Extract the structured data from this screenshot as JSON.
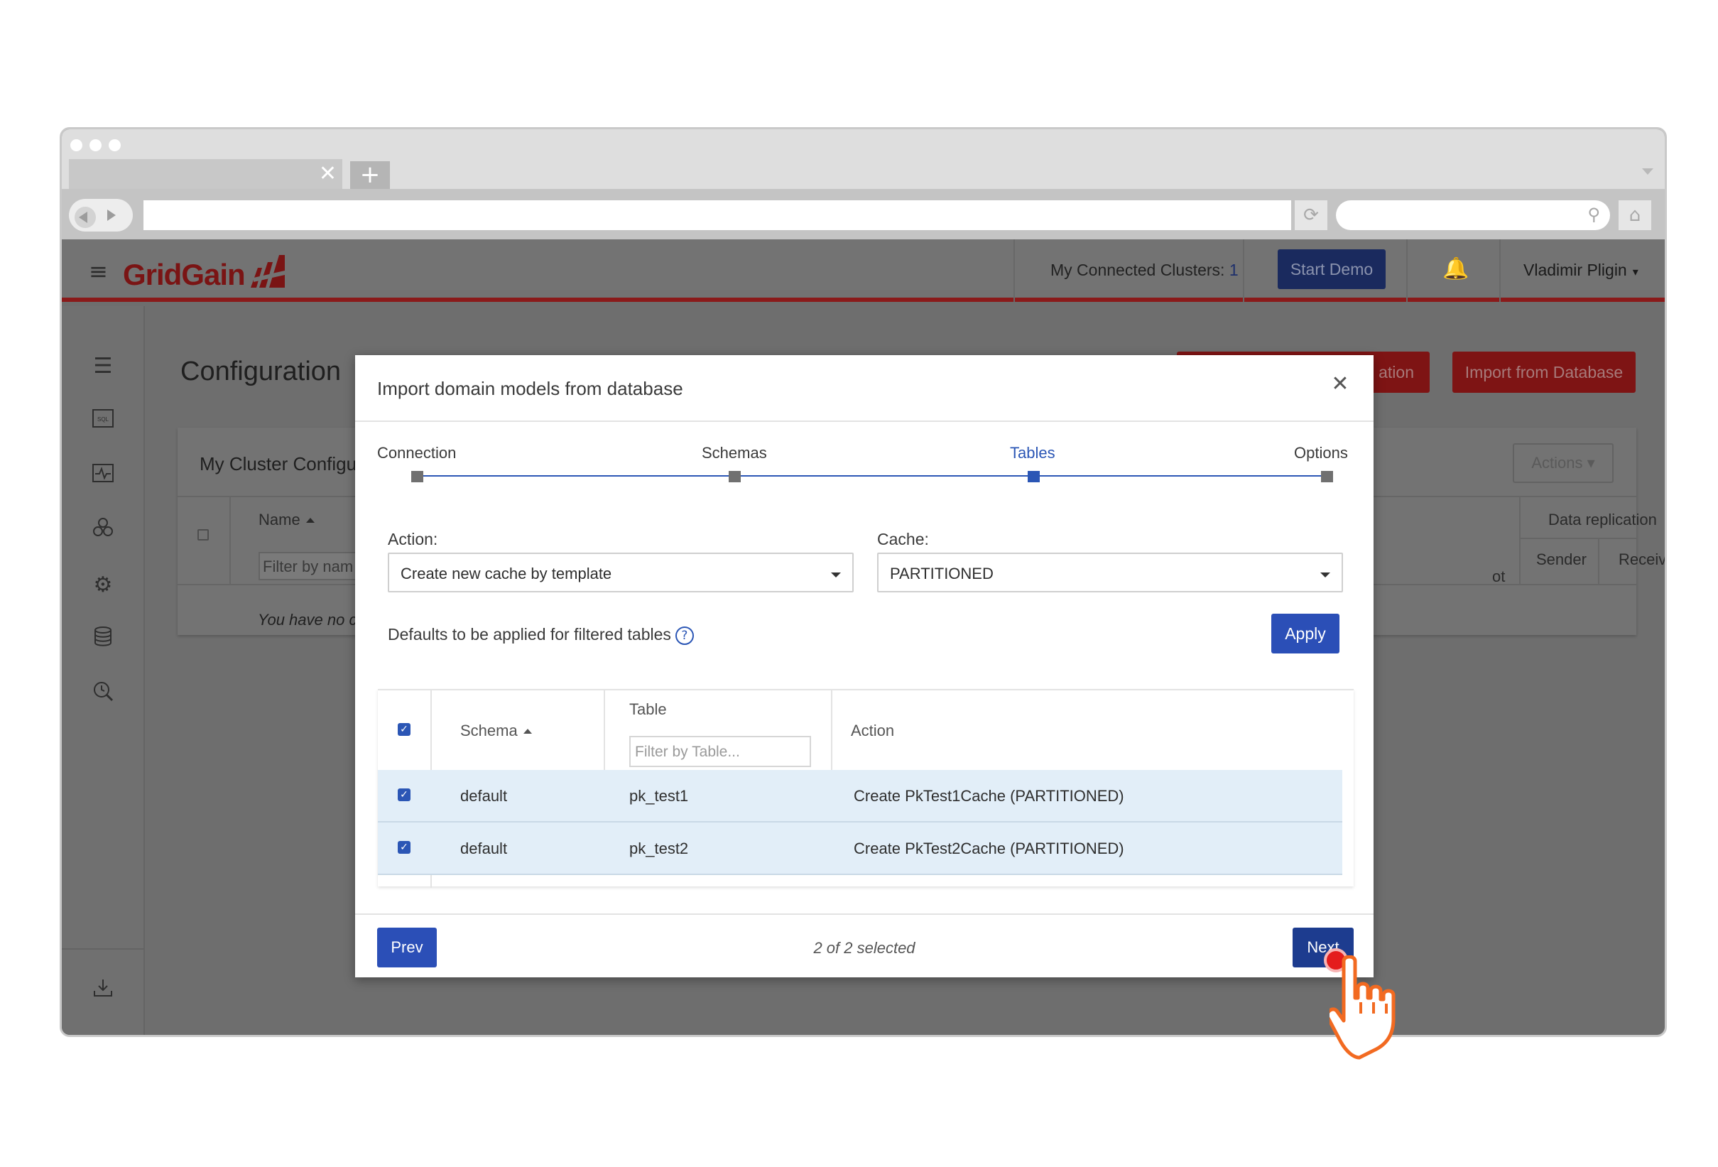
{
  "browser": {
    "tab_close": "✕",
    "new_tab": "+",
    "reload_icon": "reload-icon",
    "search_icon": "search-icon",
    "home_icon": "home-icon"
  },
  "header": {
    "logo_text": "GridGain",
    "connected_clusters_label": "My Connected Clusters:",
    "connected_clusters_count": "1",
    "start_demo": "Start Demo",
    "user_name": "Vladimir Pligin"
  },
  "sidebar": {
    "items": [
      {
        "icon": "sliders-icon"
      },
      {
        "icon": "sql-icon"
      },
      {
        "icon": "monitoring-icon"
      },
      {
        "icon": "cluster-icon"
      },
      {
        "icon": "gear-icon"
      },
      {
        "icon": "database-icon"
      },
      {
        "icon": "search-clock-icon"
      },
      {
        "icon": "download-icon"
      }
    ]
  },
  "page": {
    "title": "Configuration",
    "create_button_partial": "ation",
    "import_button": "Import from Database",
    "card_title": "My Cluster Configu",
    "actions_button": "Actions",
    "col_name": "Name",
    "filter_placeholder": "Filter by nam",
    "col_snapshot_partial": "ot",
    "col_data_replication": "Data replication",
    "col_sender": "Sender",
    "col_receiver": "Receiver",
    "empty_text": "You have no c"
  },
  "modal": {
    "title": "Import domain models from database",
    "steps": [
      {
        "label": "Connection",
        "active": false
      },
      {
        "label": "Schemas",
        "active": false
      },
      {
        "label": "Tables",
        "active": true
      },
      {
        "label": "Options",
        "active": false
      }
    ],
    "action_label": "Action:",
    "action_value": "Create new cache by template",
    "cache_label": "Cache:",
    "cache_value": "PARTITIONED",
    "defaults_text": "Defaults to be applied for filtered tables",
    "help_glyph": "?",
    "apply_button": "Apply",
    "grid": {
      "col_schema": "Schema",
      "col_table": "Table",
      "table_filter_placeholder": "Filter by Table...",
      "col_action": "Action",
      "rows": [
        {
          "schema": "default",
          "table": "pk_test1",
          "action": "Create PkTest1Cache (PARTITIONED)",
          "checked": true
        },
        {
          "schema": "default",
          "table": "pk_test2",
          "action": "Create PkTest2Cache (PARTITIONED)",
          "checked": true
        }
      ]
    },
    "prev_button": "Prev",
    "selection_status": "2 of 2 selected",
    "next_button": "Next"
  },
  "colors": {
    "accent_blue": "#2b4fb7",
    "brand_red": "#c8102e",
    "row_selected": "#e2eef8",
    "pointer_orange": "#f26a21"
  }
}
